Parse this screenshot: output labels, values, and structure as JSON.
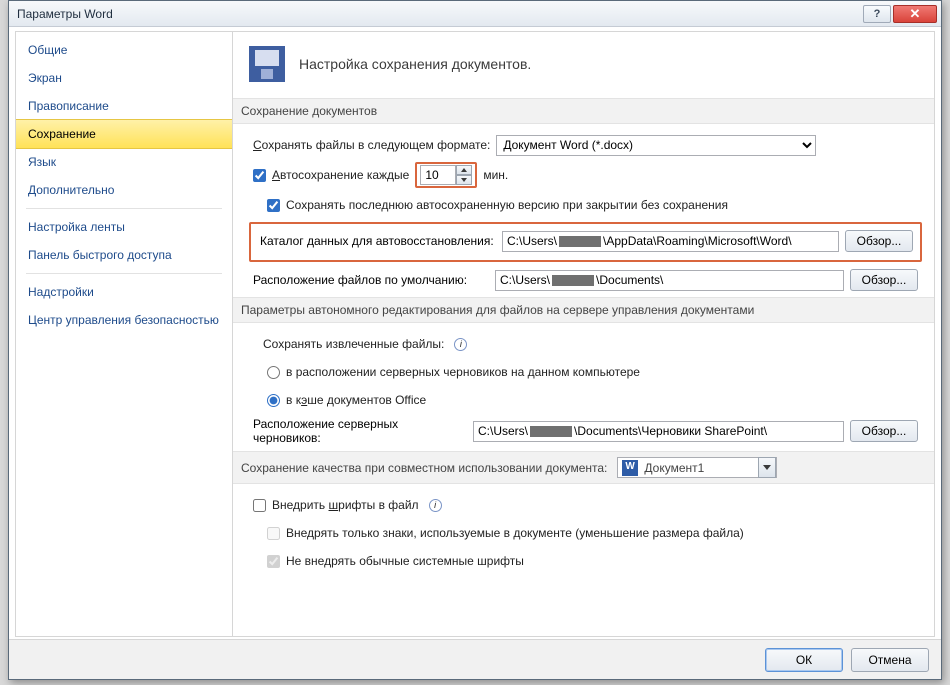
{
  "titlebar": {
    "title": "Параметры Word"
  },
  "sidebar": {
    "items": [
      "Общие",
      "Экран",
      "Правописание",
      "Сохранение",
      "Язык",
      "Дополнительно",
      "Настройка ленты",
      "Панель быстрого доступа",
      "Надстройки",
      "Центр управления безопасностью"
    ],
    "selected_index": 3
  },
  "heading": "Настройка сохранения документов.",
  "sec1": {
    "title": "Сохранение документов",
    "save_format_label": "Сохранять файлы в следующем формате:",
    "save_format_value": "Документ Word (*.docx)",
    "autosave_label": "Автосохранение каждые",
    "autosave_minutes": "10",
    "autosave_unit": "мин.",
    "keep_last_label": "Сохранять последнюю автосохраненную версию при закрытии без сохранения",
    "autorecover_label": "Каталог данных для автовосстановления:",
    "autorecover_path_pre": "C:\\Users\\",
    "autorecover_path_post": "\\AppData\\Roaming\\Microsoft\\Word\\",
    "default_loc_label": "Расположение файлов по умолчанию:",
    "default_loc_pre": "C:\\Users\\",
    "default_loc_post": "\\Documents\\",
    "browse": "Обзор..."
  },
  "sec2": {
    "title": "Параметры автономного редактирования для файлов на сервере управления документами",
    "save_checked_label": "Сохранять извлеченные файлы:",
    "opt1": "в расположении серверных черновиков на данном компьютере",
    "opt2": "в кэше документов Office",
    "drafts_label": "Расположение серверных черновиков:",
    "drafts_pre": "C:\\Users\\",
    "drafts_post": "\\Documents\\Черновики SharePoint\\",
    "browse": "Обзор..."
  },
  "sec3": {
    "title": "Сохранение качества при совместном использовании документа:",
    "doc_name": "Документ1",
    "embed_label": "Внедрить шрифты в файл",
    "embed_sub1": "Внедрять только знаки, используемые в документе (уменьшение размера файла)",
    "embed_sub2": "Не внедрять обычные системные шрифты"
  },
  "footer": {
    "ok": "ОК",
    "cancel": "Отмена"
  }
}
